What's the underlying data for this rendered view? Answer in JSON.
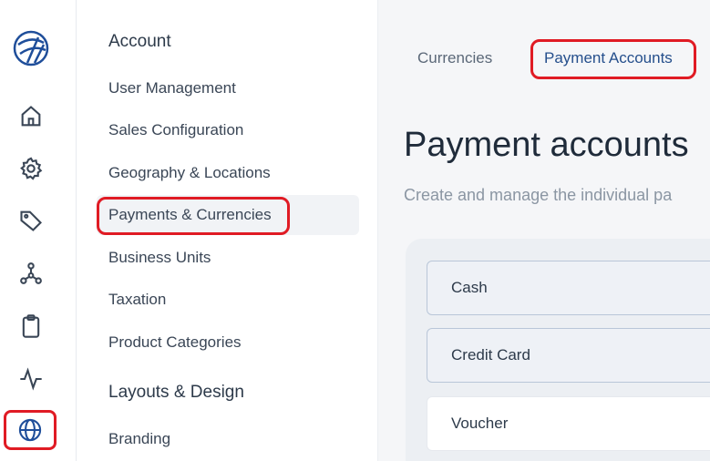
{
  "rail": {
    "icons": [
      "logo-icon",
      "home-icon",
      "gear-icon",
      "tag-icon",
      "network-icon",
      "clipboard-icon",
      "activity-icon",
      "globe-icon"
    ]
  },
  "menu": {
    "sections": [
      {
        "title": "Account",
        "items": [
          "User Management",
          "Sales Configuration",
          "Geography & Locations",
          "Payments & Currencies",
          "Business Units",
          "Taxation",
          "Product Categories"
        ]
      },
      {
        "title": "Layouts & Design",
        "items": [
          "Branding"
        ]
      }
    ]
  },
  "main": {
    "tabs": [
      "Currencies",
      "Payment Accounts"
    ],
    "title": "Payment accounts",
    "subtitle": "Create and manage the individual pa",
    "accounts": [
      "Cash",
      "Credit Card",
      "Voucher"
    ]
  },
  "colors": {
    "accent": "#254f8c",
    "highlight": "#e01b24"
  }
}
